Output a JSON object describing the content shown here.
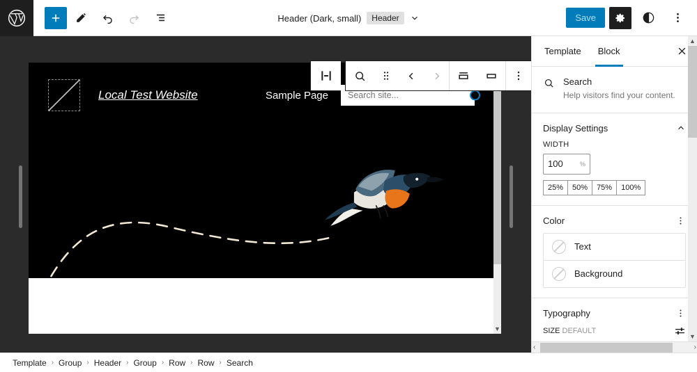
{
  "topbar": {
    "logo_icon": "wordpress-logo-icon",
    "add_label": "+",
    "add_icon": "plus-icon",
    "edit_icon": "pencil-icon",
    "undo_icon": "undo-icon",
    "redo_icon": "redo-icon",
    "listview_icon": "list-view-icon",
    "document_title": "Header (Dark, small)",
    "document_badge": "Header",
    "document_chevron_icon": "chevron-down-icon",
    "save_label": "Save",
    "settings_icon": "gear-icon",
    "styles_icon": "contrast-half-circle-icon",
    "more_icon": "kebab-vertical-icon",
    "accent_color": "#007cba",
    "dark_color": "#1e1e1e"
  },
  "block_toolbar": {
    "parent_select_icon": "select-parent-block-icon",
    "block_type_icon": "search-icon",
    "drag_icon": "drag-handle-dots-icon",
    "move_left_icon": "chevron-left-icon",
    "move_right_icon": "chevron-right-icon",
    "button_position_icon": "button-inside-icon",
    "button_outside_icon": "button-outside-icon",
    "options_icon": "kebab-vertical-icon"
  },
  "canvas": {
    "site_title": "Local Test Website",
    "logo_placeholder_icon": "image-placeholder-icon",
    "nav_link": "Sample Page",
    "search_placeholder": "Search site...",
    "search_value": "",
    "search_button_icon": "search-circle-icon",
    "bird_image_alt": "flying-bird-illustration",
    "background_color": "#000000",
    "left_resize_handle": "resize-handle-left",
    "right_resize_handle": "resize-handle-right",
    "scroll_up_icon": "chevron-up-icon",
    "scroll_down_icon": "chevron-down-icon",
    "scroll_left_icon": "chevron-left-icon",
    "scroll_right_icon": "chevron-right-icon"
  },
  "sidebar": {
    "tabs": [
      {
        "label": "Template",
        "active": false
      },
      {
        "label": "Block",
        "active": true
      }
    ],
    "close_icon": "close-x-icon",
    "block_card": {
      "icon": "search-icon",
      "title": "Search",
      "description": "Help visitors find your content."
    },
    "display_settings": {
      "title": "Display Settings",
      "collapse_icon": "chevron-up-icon",
      "width_label": "WIDTH",
      "width_value": "100",
      "width_unit": "%",
      "presets": [
        "25%",
        "50%",
        "75%",
        "100%"
      ]
    },
    "color": {
      "title": "Color",
      "options_icon": "kebab-vertical-icon",
      "rows": [
        {
          "label": "Text",
          "swatch": "none"
        },
        {
          "label": "Background",
          "swatch": "none"
        }
      ]
    },
    "typography": {
      "title": "Typography",
      "options_icon": "kebab-vertical-icon",
      "size_label": "SIZE",
      "size_value": "DEFAULT",
      "sliders_icon": "sliders-settings-icon"
    },
    "scroll_up_icon": "chevron-up-icon",
    "scroll_down_icon": "chevron-down-icon",
    "scroll_left_icon": "chevron-left-icon",
    "scroll_right_icon": "chevron-right-icon"
  },
  "breadcrumb": {
    "separator": "›",
    "items": [
      "Template",
      "Group",
      "Header",
      "Group",
      "Row",
      "Row",
      "Search"
    ]
  }
}
